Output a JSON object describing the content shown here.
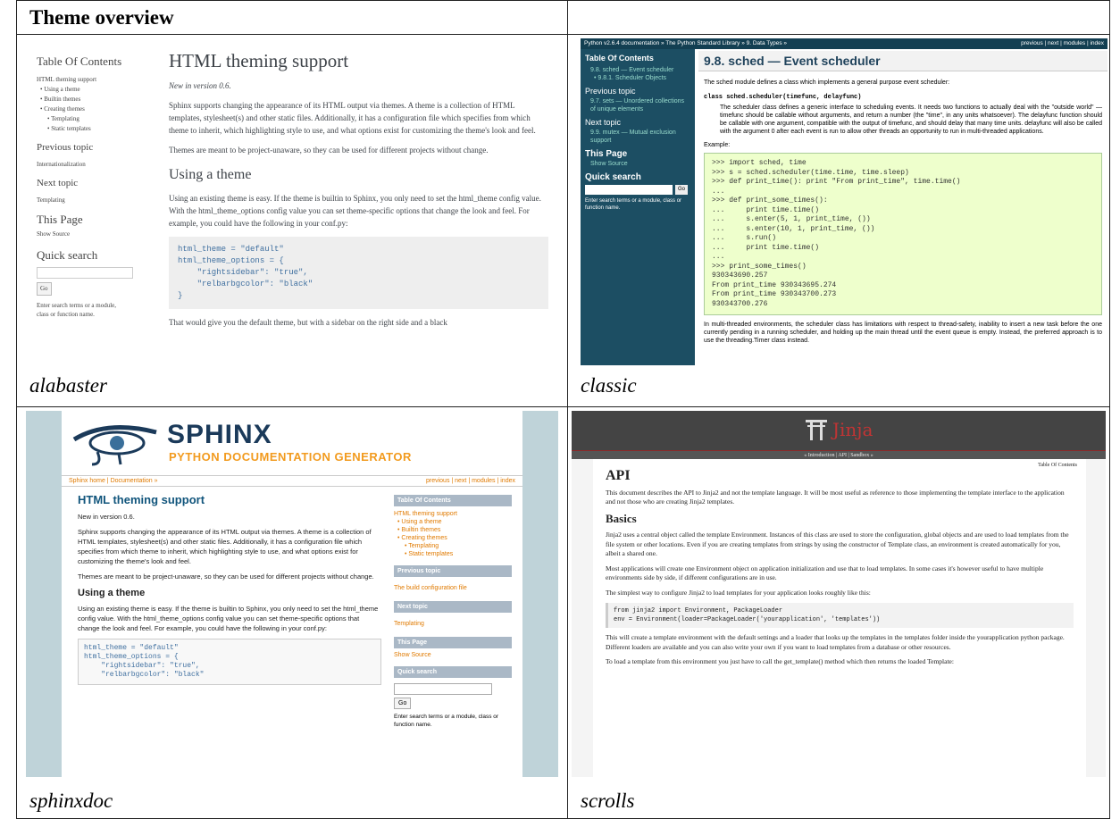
{
  "table": {
    "header_title": "Theme overview",
    "cells": [
      {
        "caption": "alabaster"
      },
      {
        "caption": "classic"
      },
      {
        "caption": "sphinxdoc"
      },
      {
        "caption": "scrolls"
      }
    ]
  },
  "alabaster": {
    "sidebar": {
      "toc_title": "Table Of Contents",
      "toc_items": [
        "HTML theming support",
        "Using a theme",
        "Builtin themes",
        "Creating themes",
        "Templating",
        "Static templates"
      ],
      "prev_title": "Previous topic",
      "prev_link": "Internationalization",
      "next_title": "Next topic",
      "next_link": "Templating",
      "this_page": "This Page",
      "show_source": "Show Source",
      "search_title": "Quick search",
      "go": "Go",
      "search_hint": "Enter search terms or a module, class or function name."
    },
    "title": "HTML theming support",
    "version": "New in version 0.6.",
    "p1": "Sphinx supports changing the appearance of its HTML output via themes. A theme is a collection of HTML templates, stylesheet(s) and other static files. Additionally, it has a configuration file which specifies from which theme to inherit, which highlighting style to use, and what options exist for customizing the theme's look and feel.",
    "p2": "Themes are meant to be project-unaware, so they can be used for different projects without change.",
    "h2": "Using a theme",
    "p3": "Using an existing theme is easy. If the theme is builtin to Sphinx, you only need to set the html_theme config value. With the html_theme_options config value you can set theme-specific options that change the look and feel. For example, you could have the following in your conf.py:",
    "code": "html_theme = \"default\"\nhtml_theme_options = {\n    \"rightsidebar\": \"true\",\n    \"relbarbgcolor\": \"black\"\n}",
    "p4": "That would give you the default theme, but with a sidebar on the right side and a black"
  },
  "classic": {
    "top_left": "Python v2.6.4 documentation » The Python Standard Library » 9. Data Types »",
    "top_right": "previous | next | modules | index",
    "sidebar": {
      "toc_title": "Table Of Contents",
      "toc_items": [
        "9.8. sched — Event scheduler",
        "9.8.1. Scheduler Objects"
      ],
      "prev_title": "Previous topic",
      "prev_link": "9.7. sets — Unordered collections of unique elements",
      "next_title": "Next topic",
      "next_link": "9.9. mutex — Mutual exclusion support",
      "this_page": "This Page",
      "show_source": "Show Source",
      "search_title": "Quick search",
      "go": "Go",
      "search_hint": "Enter search terms or a module, class or function name."
    },
    "title": "9.8. sched — Event scheduler",
    "p1": "The sched module defines a class which implements a general purpose event scheduler:",
    "sig": "class sched.scheduler(timefunc, delayfunc)",
    "p2": "The scheduler class defines a generic interface to scheduling events. It needs two functions to actually deal with the \"outside world\" — timefunc should be callable without arguments, and return a number (the \"time\", in any units whatsoever). The delayfunc function should be callable with one argument, compatible with the output of timefunc, and should delay that many time units. delayfunc will also be called with the argument 0 after each event is run to allow other threads an opportunity to run in multi-threaded applications.",
    "example": "Example:",
    "code": ">>> import sched, time\n>>> s = sched.scheduler(time.time, time.sleep)\n>>> def print_time(): print \"From print_time\", time.time()\n...\n>>> def print_some_times():\n...     print time.time()\n...     s.enter(5, 1, print_time, ())\n...     s.enter(10, 1, print_time, ())\n...     s.run()\n...     print time.time()\n...\n>>> print_some_times()\n930343690.257\nFrom print_time 930343695.274\nFrom print_time 930343700.273\n930343700.276",
    "p3": "In multi-threaded environments, the scheduler class has limitations with respect to thread-safety, inability to insert a new task before the one currently pending in a running scheduler, and holding up the main thread until the event queue is empty. Instead, the preferred approach is to use the threading.Timer class instead."
  },
  "sphinxdoc": {
    "logo_title": "SPHINX",
    "logo_sub": "PYTHON DOCUMENTATION GENERATOR",
    "nav_left": "Sphinx home | Documentation »",
    "nav_right": "previous | next | modules | index",
    "title": "HTML theming support",
    "version": "New in version 0.6.",
    "p1": "Sphinx supports changing the appearance of its HTML output via themes. A theme is a collection of HTML templates, stylesheet(s) and other static files. Additionally, it has a configuration file which specifies from which theme to inherit, which highlighting style to use, and what options exist for customizing the theme's look and feel.",
    "p2": "Themes are meant to be project-unaware, so they can be used for different projects without change.",
    "h2": "Using a theme",
    "p3": "Using an existing theme is easy. If the theme is builtin to Sphinx, you only need to set the html_theme config value. With the html_theme_options config value you can set theme-specific options that change the look and feel. For example, you could have the following in your conf.py:",
    "code": "html_theme = \"default\"\nhtml_theme_options = {\n    \"rightsidebar\": \"true\",\n    \"relbarbgcolor\": \"black\"",
    "sidebar": {
      "toc_title": "Table Of Contents",
      "toc_items": [
        "HTML theming support",
        "Using a theme",
        "Builtin themes",
        "Creating themes",
        "Templating",
        "Static templates"
      ],
      "prev_title": "Previous topic",
      "prev_link": "The build configuration file",
      "next_title": "Next topic",
      "next_link": "Templating",
      "this_page": "This Page",
      "show_source": "Show Source",
      "search_title": "Quick search",
      "go": "Go",
      "search_hint": "Enter search terms or a module, class or function name."
    }
  },
  "scrolls": {
    "logo_text": "Jinja",
    "nav": "« Introduction | API | Sandbox »",
    "toc_link": "Table Of Contents",
    "title": "API",
    "p1": "This document describes the API to Jinja2 and not the template language. It will be most useful as reference to those implementing the template interface to the application and not those who are creating Jinja2 templates.",
    "h2": "Basics",
    "p2": "Jinja2 uses a central object called the template Environment. Instances of this class are used to store the configuration, global objects and are used to load templates from the file system or other locations. Even if you are creating templates from strings by using the constructor of Template class, an environment is created automatically for you, albeit a shared one.",
    "p3": "Most applications will create one Environment object on application initialization and use that to load templates. In some cases it's however useful to have multiple environments side by side, if different configurations are in use.",
    "p4": "The simplest way to configure Jinja2 to load templates for your application looks roughly like this:",
    "code": "from jinja2 import Environment, PackageLoader\nenv = Environment(loader=PackageLoader('yourapplication', 'templates'))",
    "p5": "This will create a template environment with the default settings and a loader that looks up the templates in the templates folder inside the yourapplication python package. Different loaders are available and you can also write your own if you want to load templates from a database or other resources.",
    "p6": "To load a template from this environment you just have to call the get_template() method which then returns the loaded Template:"
  },
  "colors": {
    "classic_sidebar": "#1c4e63",
    "classic_header": "#133f52",
    "sphinxdoc_frame": "#bfd3d9",
    "scrolls_header": "#444444",
    "scrolls_logo": "#c13434"
  }
}
